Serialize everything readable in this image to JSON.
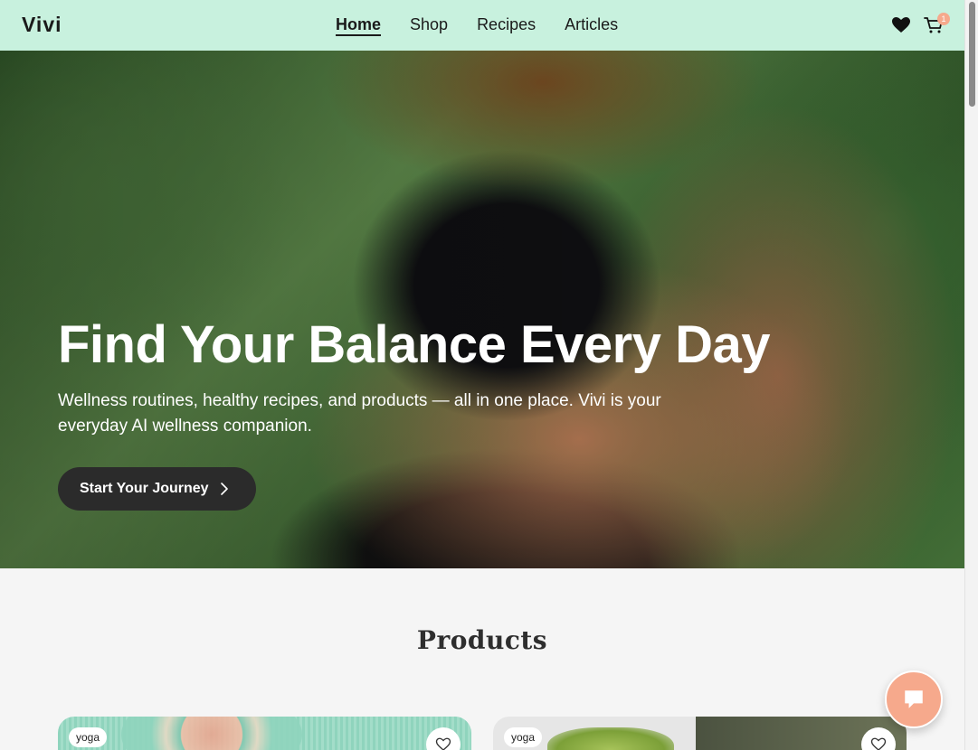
{
  "header": {
    "logo": "Vivi",
    "nav": [
      {
        "label": "Home",
        "active": true
      },
      {
        "label": "Shop",
        "active": false
      },
      {
        "label": "Recipes",
        "active": false
      },
      {
        "label": "Articles",
        "active": false
      }
    ],
    "icons": [
      "heart-icon",
      "cart-icon"
    ],
    "cart_count": "1"
  },
  "hero": {
    "title": "Find Your Balance Every Day",
    "subtitle": "Wellness routines, healthy recipes, and products — all in one place. Vivi is your everyday AI wellness companion.",
    "cta_label": "Start Your Journey"
  },
  "products": {
    "title": "Products",
    "cards": [
      {
        "tag": "yoga"
      },
      {
        "tag": "yoga"
      }
    ]
  },
  "colors": {
    "header_bg": "#c8f1de",
    "accent": "#f6a98c",
    "cta_bg": "#2b2b2b"
  }
}
